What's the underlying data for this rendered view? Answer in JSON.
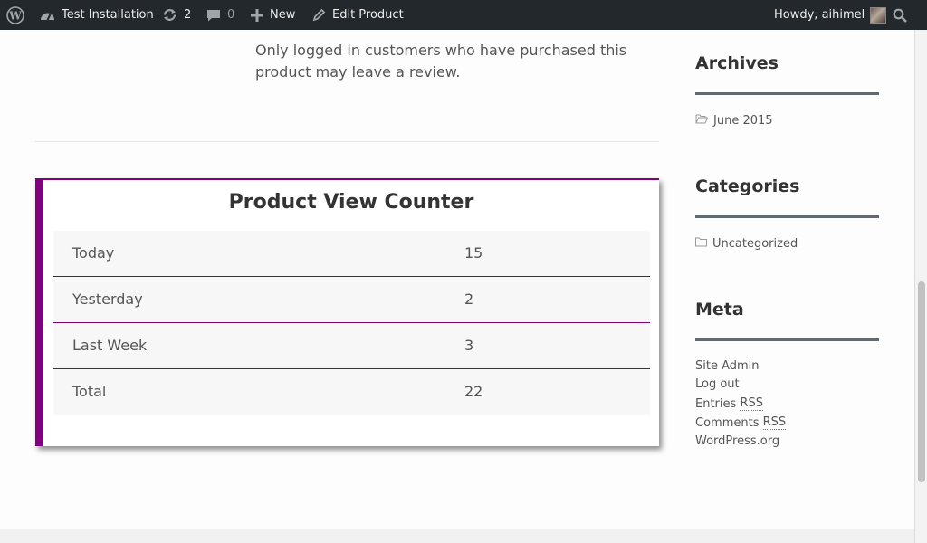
{
  "adminbar": {
    "site_name": "Test Installation",
    "updates_count": "2",
    "comments_count": "0",
    "new_label": "New",
    "edit_label": "Edit Product",
    "howdy": "Howdy, aihimel"
  },
  "content": {
    "review_note": "Only logged in customers who have purchased this product may leave a review."
  },
  "counter": {
    "title": "Product View Counter",
    "rows": [
      {
        "label": "Today",
        "value": "15"
      },
      {
        "label": "Yesterday",
        "value": "2"
      },
      {
        "label": "Last Week",
        "value": "3"
      },
      {
        "label": "Total",
        "value": "22"
      }
    ]
  },
  "sidebar": {
    "archives": {
      "title": "Archives",
      "items": [
        "June 2015"
      ]
    },
    "categories": {
      "title": "Categories",
      "items": [
        "Uncategorized"
      ]
    },
    "meta": {
      "title": "Meta",
      "site_admin": "Site Admin",
      "log_out": "Log out",
      "entries": "Entries",
      "comments": "Comments",
      "rss": "RSS",
      "wordpress": "WordPress.org"
    }
  },
  "colors": {
    "accent": "#800080",
    "adminbar_bg": "#23282d"
  }
}
